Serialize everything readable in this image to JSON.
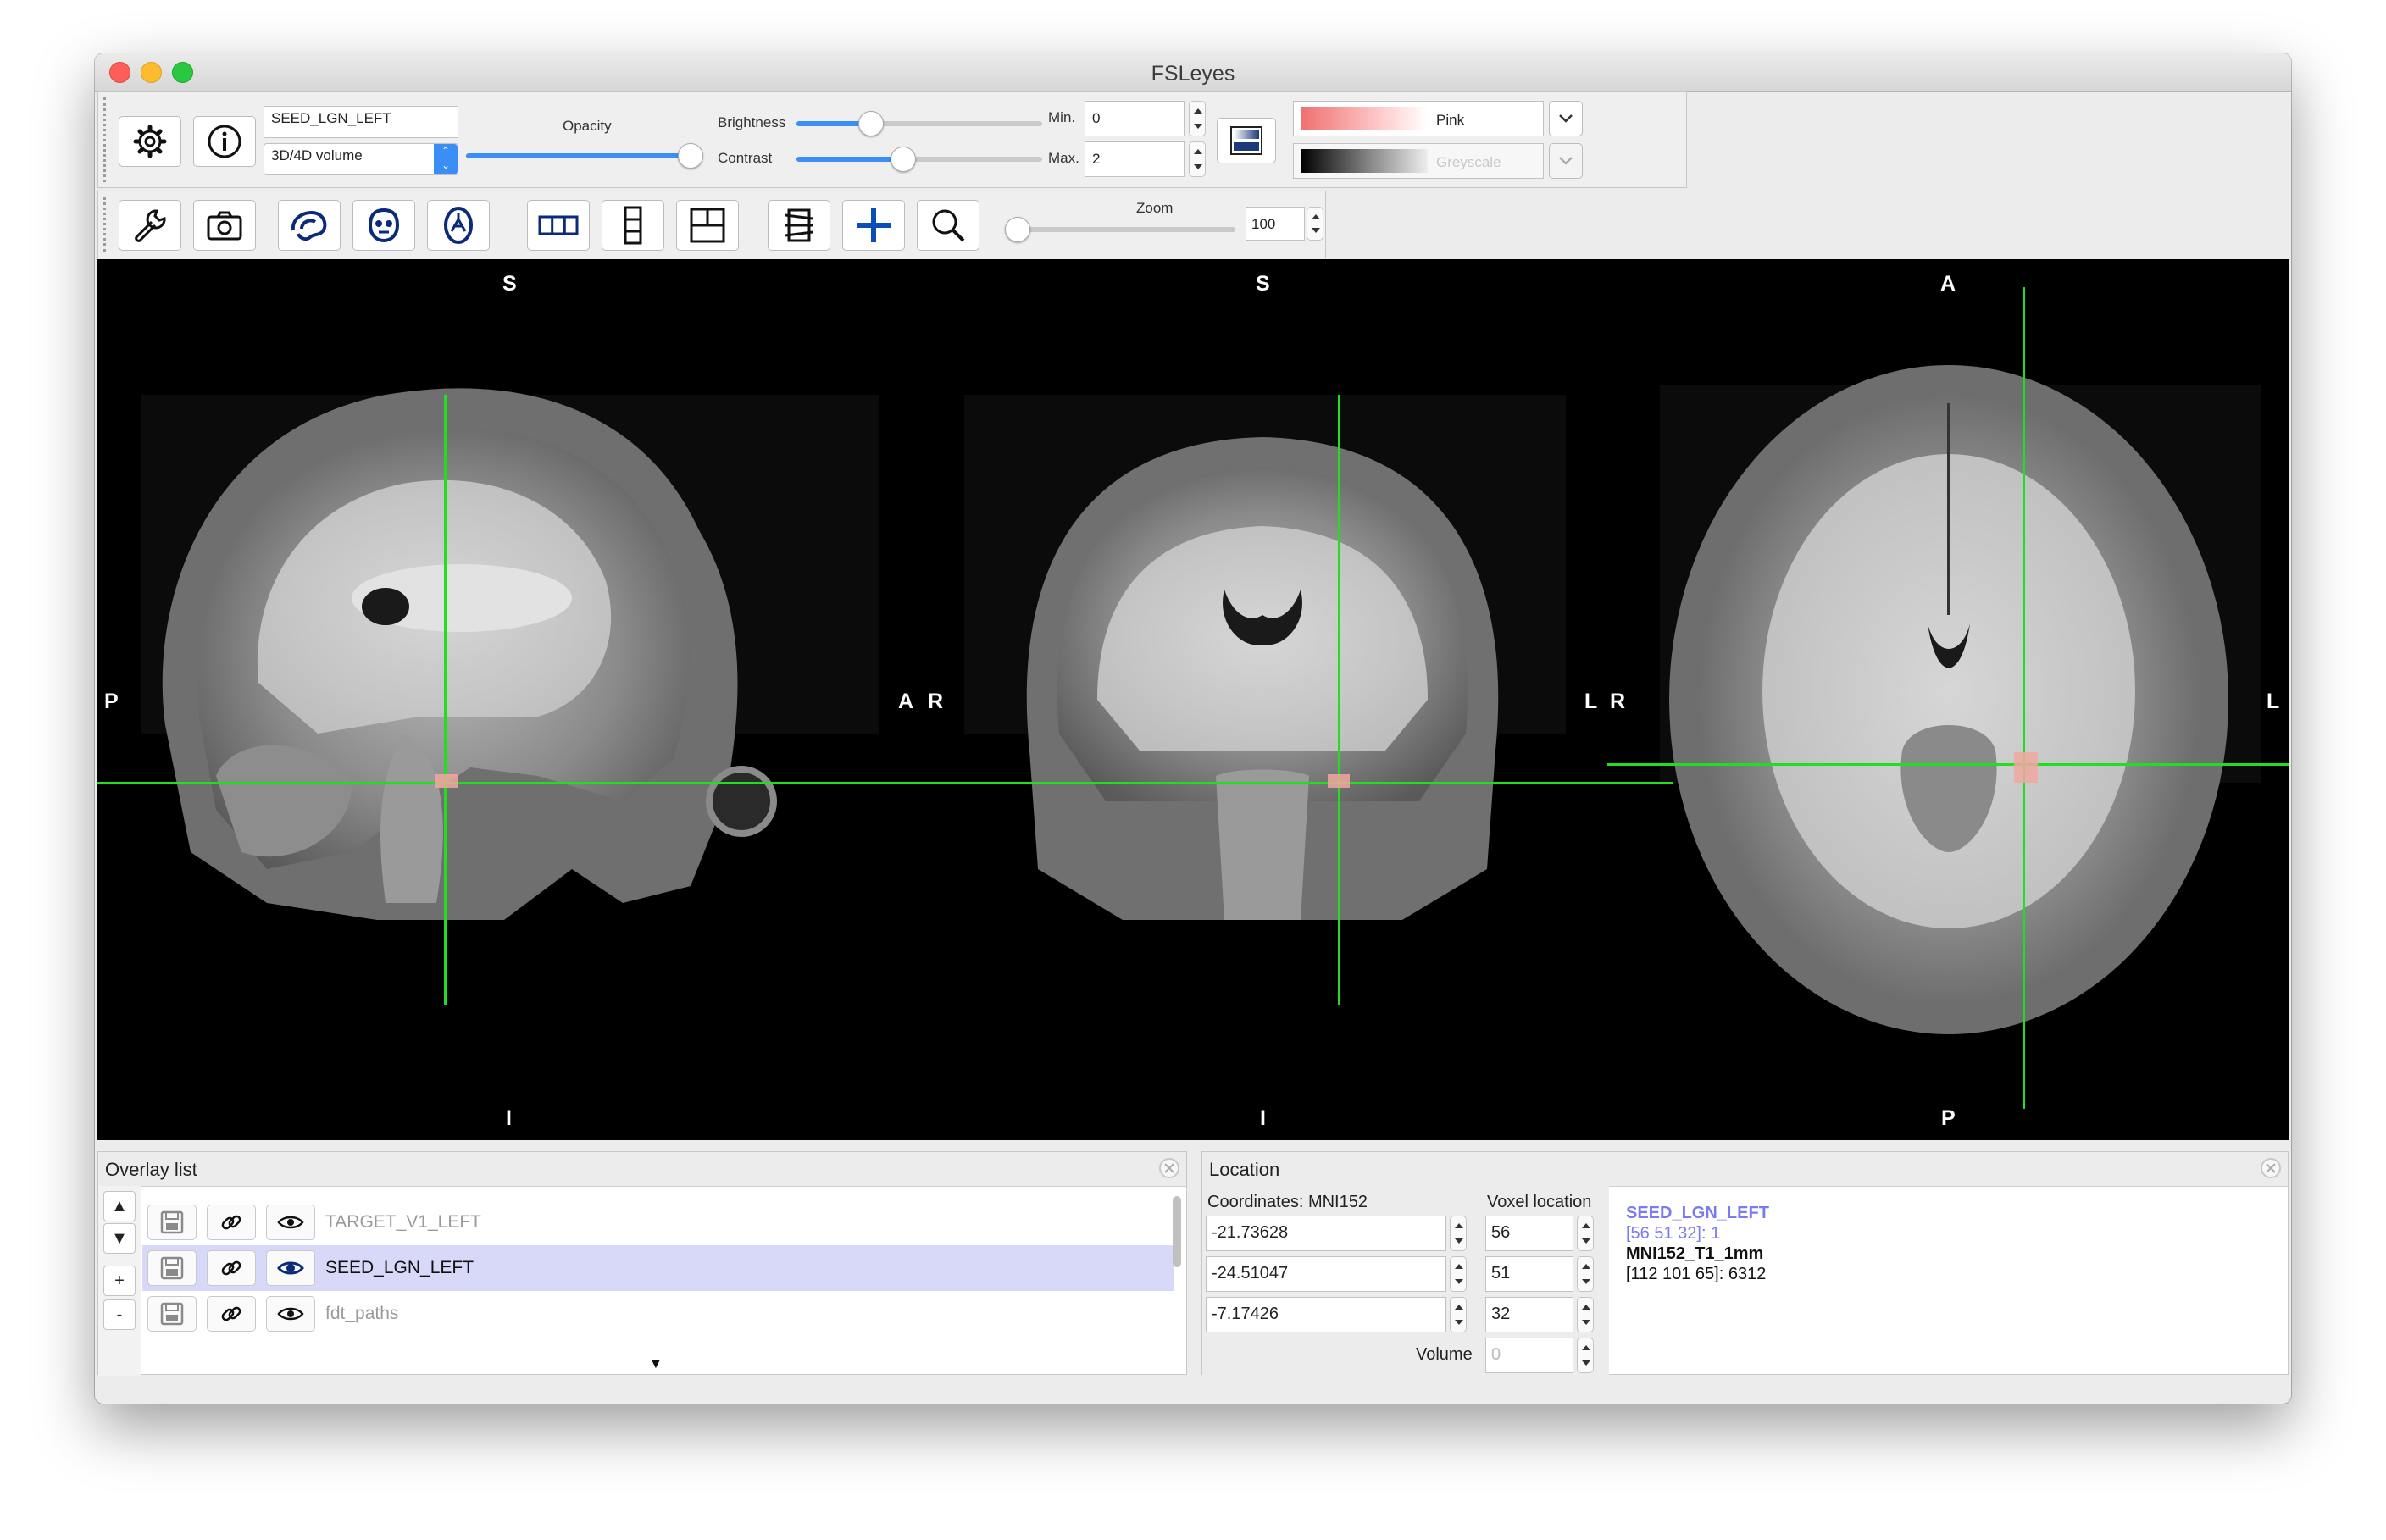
{
  "window": {
    "title": "FSLeyes"
  },
  "overlay_toolbar": {
    "overlay_name": "SEED_LGN_LEFT",
    "overlay_type": "3D/4D volume",
    "opacity_label": "Opacity",
    "brightness_label": "Brightness",
    "contrast_label": "Contrast",
    "min_label": "Min.",
    "max_label": "Max.",
    "min_value": "0",
    "max_value": "2",
    "opacity_level": 0.97,
    "brightness_level": 0.3,
    "contrast_level": 0.43,
    "colormap": "Pink",
    "neg_colormap": "Greyscale",
    "icons": [
      "gear-icon",
      "info-icon",
      "colorbar-icon",
      "chevron-down-icon"
    ]
  },
  "ortho_toolbar": {
    "zoom_label": "Zoom",
    "zoom_value": "100",
    "zoom_level": 0.0,
    "icons": [
      "wrench-icon",
      "camera-icon",
      "sagittal-icon",
      "coronal-icon",
      "axial-icon",
      "horizontal-layout-icon",
      "vertical-layout-icon",
      "grid-layout-icon",
      "movie-icon",
      "crosshair-icon",
      "zoom-icon"
    ]
  },
  "views": {
    "sagittal": {
      "top": "S",
      "bottom": "I",
      "left": "P",
      "right": "A"
    },
    "coronal": {
      "top": "S",
      "bottom": "I",
      "left": "R",
      "right": "L"
    },
    "axial": {
      "top": "A",
      "bottom": "P",
      "left": "R",
      "right": "L"
    },
    "cursor_color": "#22dd22",
    "seed_color": "#f0a8a0"
  },
  "overlay_list": {
    "title": "Overlay list",
    "items": [
      {
        "name": "TARGET_V1_LEFT",
        "selected": false,
        "dim": true
      },
      {
        "name": "SEED_LGN_LEFT",
        "selected": true,
        "dim": false
      },
      {
        "name": "fdt_paths",
        "selected": false,
        "dim": true
      }
    ],
    "move_up": "▲",
    "move_down": "▼",
    "add": "+",
    "remove": "-"
  },
  "location": {
    "title": "Location",
    "coordinates_label": "Coordinates: MNI152",
    "voxel_label": "Voxel location",
    "coords": [
      "-21.73628",
      "-24.51047",
      "-7.17426"
    ],
    "voxels": [
      "56",
      "51",
      "32"
    ],
    "volume_label": "Volume",
    "volume_value": "0",
    "info": [
      {
        "name": "SEED_LGN_LEFT",
        "value": "[56 51 32]: 1",
        "color": "#7b7bf0"
      },
      {
        "name": "MNI152_T1_1mm",
        "value": "[112 101 65]: 6312",
        "color": "#111111"
      }
    ]
  }
}
